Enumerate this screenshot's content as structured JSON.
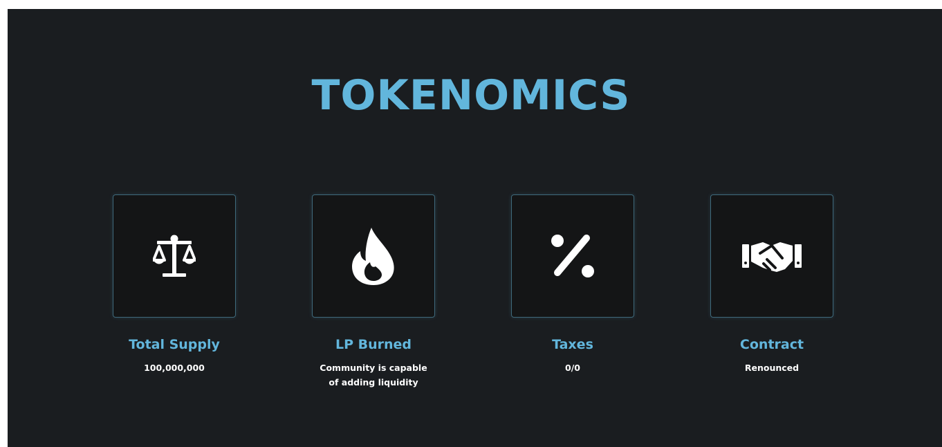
{
  "section": {
    "title": "TOKENOMICS"
  },
  "colors": {
    "background": "#1a1d20",
    "accent": "#62b6dc",
    "text": "#ffffff"
  },
  "cards": [
    {
      "icon": "balance-scale-icon",
      "label": "Total Supply",
      "value_lines": [
        "100,000,000"
      ]
    },
    {
      "icon": "fire-icon",
      "label": "LP Burned",
      "value_lines": [
        "Community is capable",
        "of adding liquidity"
      ]
    },
    {
      "icon": "percent-icon",
      "label": "Taxes",
      "value_lines": [
        "0/0"
      ]
    },
    {
      "icon": "handshake-icon",
      "label": "Contract",
      "value_lines": [
        "Renounced"
      ]
    }
  ]
}
